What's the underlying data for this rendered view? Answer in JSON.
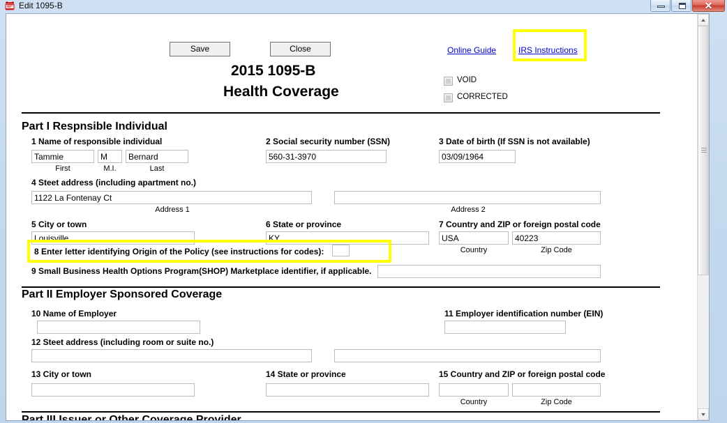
{
  "window": {
    "title": "Edit 1095-B",
    "icon": "form-document-icon",
    "minimize_label": "Minimize",
    "maximize_label": "Maximize",
    "close_label": "✕"
  },
  "toolbar": {
    "save_label": "Save",
    "close_label": "Close",
    "online_guide_label": "Online Guide",
    "irs_instructions_label": "IRS Instructions"
  },
  "form": {
    "title_line1": "2015 1095-B",
    "title_line2": "Health Coverage",
    "void_label": "VOID",
    "corrected_label": "CORRECTED"
  },
  "part1": {
    "heading": "Part I Respnsible Individual",
    "field1_label": "1 Name of responsible individual",
    "first_value": "Tammie",
    "first_sub": "First",
    "mi_value": "M",
    "mi_sub": "M.I.",
    "last_value": "Bernard",
    "last_sub": "Last",
    "field2_label": "2 Social security number (SSN)",
    "ssn_value": "560-31-3970",
    "field3_label": "3 Date of birth (If SSN is not available)",
    "dob_value": "03/09/1964",
    "field4_label": "4 Steet address (including apartment no.)",
    "address1_value": "1122 La Fontenay Ct",
    "address1_sub": "Address 1",
    "address2_value": "",
    "address2_sub": "Address 2",
    "field5_label": "5 City or town",
    "city_value": "Louisville",
    "field6_label": "6 State or province",
    "state_value": "KY",
    "field7_label": "7 Country and ZIP or foreign postal code",
    "country_value": "USA",
    "country_sub": "Country",
    "zip_value": "40223",
    "zip_sub": "Zip Code",
    "field8_label": "8 Enter letter identifying Origin of the Policy (see instructions for codes):",
    "origin_value": "",
    "field9_label": "9 Small Business Health Options Program(SHOP) Marketplace identifier, if applicable.",
    "shop_value": ""
  },
  "part2": {
    "heading": "Part II Employer Sponsored Coverage",
    "field10_label": "10 Name of  Employer",
    "employer_value": "",
    "field11_label": "11 Employer identification number (EIN)",
    "ein_value": "",
    "field12_label": "12 Steet address (including room or suite no.)",
    "address1_value": "",
    "address2_value": "",
    "field13_label": "13 City or town",
    "city_value": "",
    "field14_label": "14 State or province",
    "state_value": "",
    "field15_label": "15 Country and ZIP or foreign postal code",
    "country_value": "",
    "country_sub": "Country",
    "zip_value": "",
    "zip_sub": "Zip Code"
  },
  "part3": {
    "heading": "Part III Issuer or Other Coverage Provider"
  },
  "colors": {
    "highlight": "#ffff00",
    "link": "#0000cc",
    "titlebar": "#c3d8ee"
  }
}
